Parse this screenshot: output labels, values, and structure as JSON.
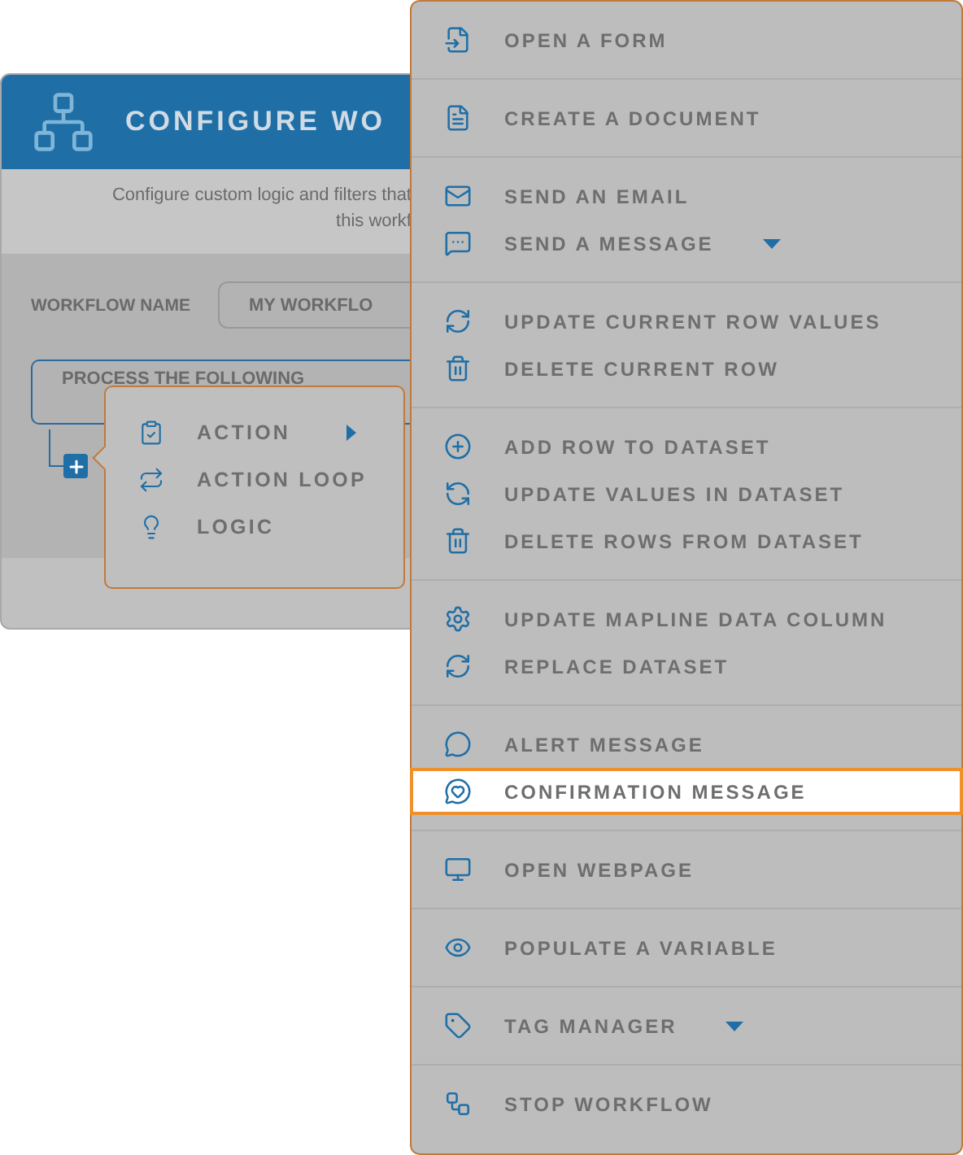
{
  "dialog": {
    "title": "CONFIGURE WO",
    "description": [
      "Configure custom logic and filters that",
      "this workf"
    ],
    "name_label": "WORKFLOW NAME",
    "name_value": "MY WORKFLO",
    "step": "PROCESS THE FOLLOWING"
  },
  "popup": {
    "items": [
      {
        "label": "ACTION",
        "submenu": true
      },
      {
        "label": "ACTION LOOP",
        "submenu": false
      },
      {
        "label": "LOGIC",
        "submenu": false
      }
    ]
  },
  "menu": {
    "groups": [
      {
        "items": [
          {
            "label": "OPEN A FORM",
            "dropdown": false,
            "selected": false
          }
        ]
      },
      {
        "items": [
          {
            "label": "CREATE A DOCUMENT",
            "dropdown": false,
            "selected": false
          }
        ]
      },
      {
        "items": [
          {
            "label": "SEND AN EMAIL",
            "dropdown": false,
            "selected": false
          },
          {
            "label": "SEND A MESSAGE",
            "dropdown": true,
            "selected": false
          }
        ]
      },
      {
        "items": [
          {
            "label": "UPDATE CURRENT ROW VALUES",
            "dropdown": false,
            "selected": false
          },
          {
            "label": "DELETE CURRENT ROW",
            "dropdown": false,
            "selected": false
          }
        ]
      },
      {
        "items": [
          {
            "label": "ADD ROW TO DATASET",
            "dropdown": false,
            "selected": false
          },
          {
            "label": "UPDATE VALUES IN DATASET",
            "dropdown": false,
            "selected": false
          },
          {
            "label": "DELETE ROWS FROM DATASET",
            "dropdown": false,
            "selected": false
          }
        ]
      },
      {
        "items": [
          {
            "label": "UPDATE MAPLINE DATA COLUMN",
            "dropdown": false,
            "selected": false
          },
          {
            "label": "REPLACE DATASET",
            "dropdown": false,
            "selected": false
          }
        ]
      },
      {
        "items": [
          {
            "label": "ALERT MESSAGE",
            "dropdown": false,
            "selected": false
          },
          {
            "label": "CONFIRMATION MESSAGE",
            "dropdown": false,
            "selected": true
          }
        ]
      },
      {
        "items": [
          {
            "label": "OPEN WEBPAGE",
            "dropdown": false,
            "selected": false
          }
        ]
      },
      {
        "items": [
          {
            "label": "POPULATE A VARIABLE",
            "dropdown": false,
            "selected": false
          }
        ]
      },
      {
        "items": [
          {
            "label": "TAG MANAGER",
            "dropdown": true,
            "selected": false
          }
        ]
      },
      {
        "items": [
          {
            "label": "STOP WORKFLOW",
            "dropdown": false,
            "selected": false
          }
        ]
      }
    ]
  }
}
